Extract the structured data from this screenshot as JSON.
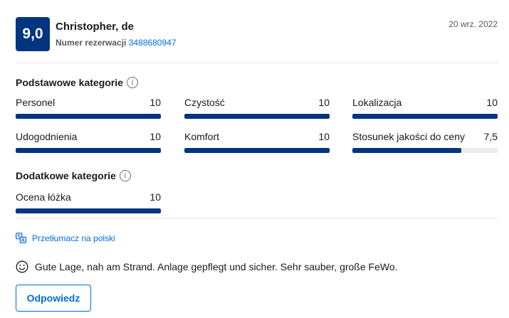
{
  "review": {
    "score": "9,0",
    "reviewer": "Christopher, de",
    "booking_label": "Numer rezerwacji",
    "booking_number": "3488680947",
    "date": "20 wrz. 2022"
  },
  "basic_categories": {
    "title": "Podstawowe kategorie",
    "items": [
      {
        "label": "Personel",
        "value": "10",
        "fraction": 1.0
      },
      {
        "label": "Czystość",
        "value": "10",
        "fraction": 1.0
      },
      {
        "label": "Lokalizacja",
        "value": "10",
        "fraction": 1.0
      },
      {
        "label": "Udogodnienia",
        "value": "10",
        "fraction": 1.0
      },
      {
        "label": "Komfort",
        "value": "10",
        "fraction": 1.0
      },
      {
        "label": "Stosunek jakości do ceny",
        "value": "7,5",
        "fraction": 0.75
      }
    ]
  },
  "additional_categories": {
    "title": "Dodatkowe kategorie",
    "items": [
      {
        "label": "Ocena łóżka",
        "value": "10",
        "fraction": 1.0
      }
    ]
  },
  "translate_link": "Przetłumacz na polski",
  "review_text": "Gute Lage, nah am Strand. Anlage gepflegt und sicher. Sehr sauber, große FeWo.",
  "reply_button": "Odpowiedz",
  "colors": {
    "brand": "#003580",
    "link": "#006ce4",
    "track": "#ebebeb"
  },
  "icons": {
    "info": "info-icon",
    "translate": "translate-icon",
    "review_mood": "smile-icon"
  }
}
